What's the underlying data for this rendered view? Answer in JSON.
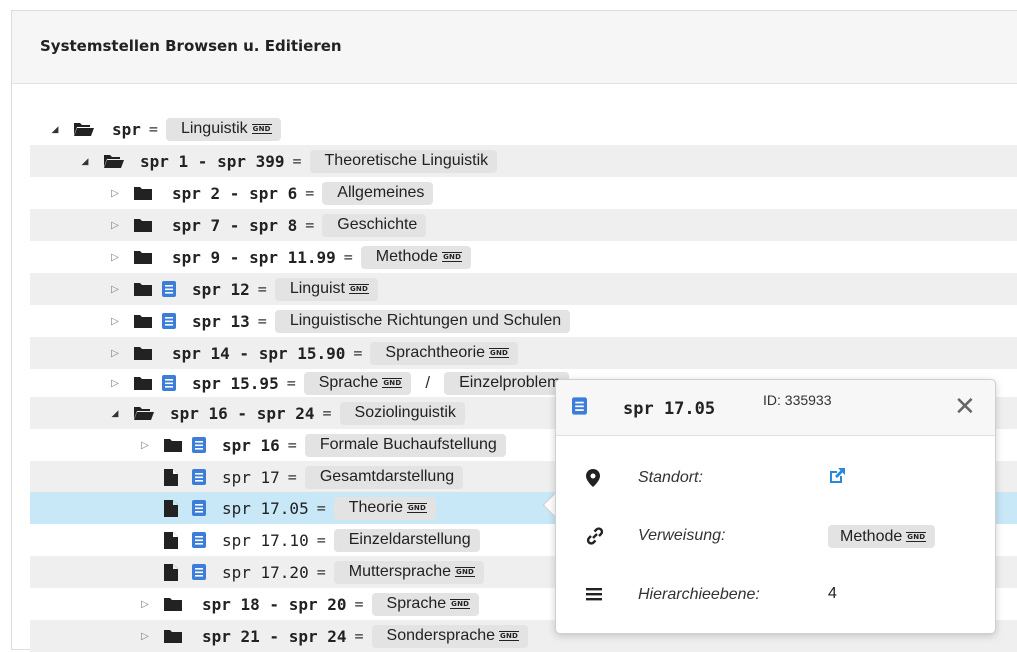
{
  "panel": {
    "title": "Systemstellen Browsen u. Editieren"
  },
  "gnd_badge": "GND",
  "tree": [
    {
      "code": "spr",
      "label": "Linguistik",
      "gnd": true
    },
    {
      "code": "spr 1 - spr 399",
      "label": "Theoretische Linguistik"
    },
    {
      "code": "spr 2 - spr 6",
      "label": "Allgemeines"
    },
    {
      "code": "spr 7 - spr 8",
      "label": "Geschichte"
    },
    {
      "code": "spr 9 - spr 11.99",
      "label": "Methode",
      "gnd": true
    },
    {
      "code": "spr 12",
      "label": "Linguist",
      "gnd": true
    },
    {
      "code": "spr 13",
      "label": "Linguistische Richtungen und Schulen"
    },
    {
      "code": "spr 14 - spr 15.90",
      "label": "Sprachtheorie",
      "gnd": true
    },
    {
      "code": "spr 15.95",
      "label": "Sprache",
      "gnd": true,
      "separator": "/",
      "label2": "Einzelproblem"
    },
    {
      "code": "spr 16 - spr 24",
      "label": "Soziolinguistik"
    },
    {
      "code": "spr 16",
      "label": "Formale Buchaufstellung"
    },
    {
      "code": "spr 17",
      "label": "Gesamtdarstellung"
    },
    {
      "code": "spr 17.05",
      "label": "Theorie",
      "gnd": true
    },
    {
      "code": "spr 17.10",
      "label": "Einzeldarstellung"
    },
    {
      "code": "spr 17.20",
      "label": "Muttersprache",
      "gnd": true
    },
    {
      "code": "spr 18 - spr 20",
      "label": "Sprache",
      "gnd": true
    },
    {
      "code": "spr 21 - spr 24",
      "label": "Sondersprache",
      "gnd": true
    }
  ],
  "popup": {
    "code": "spr 17.05",
    "id": "ID: 335933",
    "close": "✕",
    "standort_label": "Standort:",
    "verweisung_label": "Verweisung:",
    "verweisung_value": "Methode",
    "hierarchie_label": "Hierarchieebene:",
    "hierarchie_value": "4"
  },
  "colors": {
    "selected_row": "#c8e7f7",
    "book_icon": "#3b7dd8",
    "link_icon": "#2a8ad8"
  }
}
